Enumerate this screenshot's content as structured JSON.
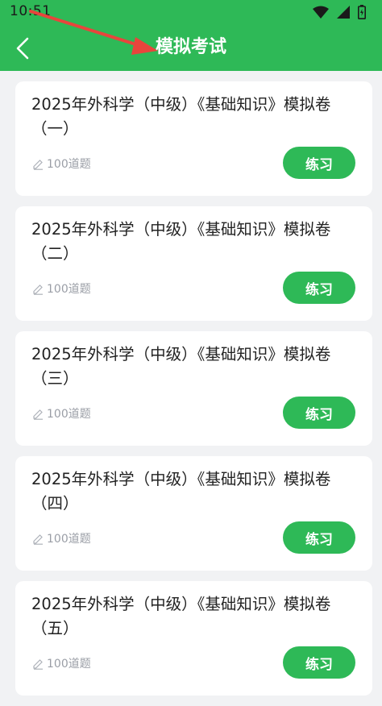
{
  "status_bar": {
    "time": "10:51"
  },
  "header": {
    "title": "模拟考试",
    "back_icon": "chevron-left-icon",
    "accent": "#2eb957"
  },
  "exams": [
    {
      "title": "2025年外科学（中级）《基础知识》模拟卷（一）",
      "questions": "100道题",
      "action": "练习"
    },
    {
      "title": "2025年外科学（中级）《基础知识》模拟卷（二）",
      "questions": "100道题",
      "action": "练习"
    },
    {
      "title": "2025年外科学（中级）《基础知识》模拟卷（三）",
      "questions": "100道题",
      "action": "练习"
    },
    {
      "title": "2025年外科学（中级）《基础知识》模拟卷（四）",
      "questions": "100道题",
      "action": "练习"
    },
    {
      "title": "2025年外科学（中级）《基础知识》模拟卷（五）",
      "questions": "100道题",
      "action": "练习"
    }
  ]
}
